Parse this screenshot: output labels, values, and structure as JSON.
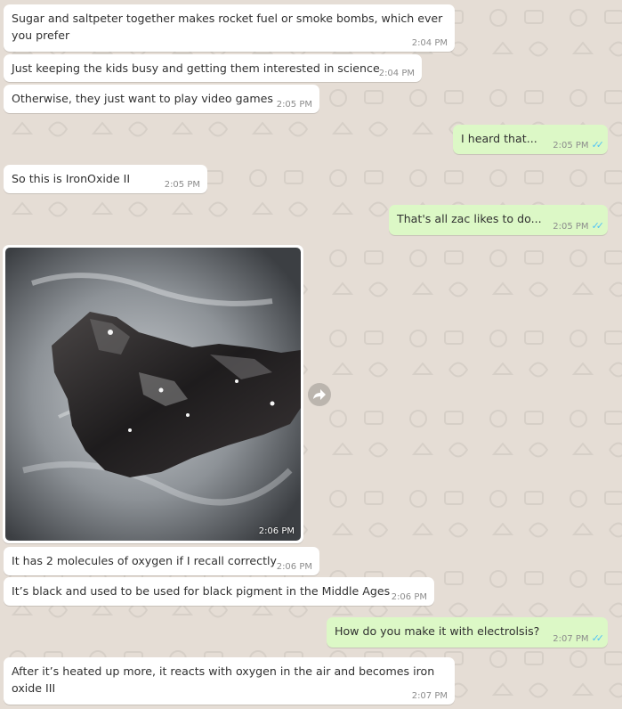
{
  "messages": [
    {
      "text": "Sugar and saltpeter together makes rocket fuel or smoke bombs, which ever you prefer",
      "time": "2:04 PM"
    },
    {
      "text": "Just keeping the kids busy and getting them interested in science",
      "time": "2:04 PM"
    },
    {
      "text": "Otherwise, they just want to play video games",
      "time": "2:05 PM"
    },
    {
      "text": "I heard that...",
      "time": "2:05 PM"
    },
    {
      "text": "So this is IronOxide II",
      "time": "2:05 PM"
    },
    {
      "text": "That's all zac likes to do...",
      "time": "2:05 PM"
    },
    {
      "text": "",
      "time": "2:06 PM"
    },
    {
      "text": "It has 2 molecules of oxygen if I recall correctly",
      "time": "2:06 PM"
    },
    {
      "text": "It’s black and used to be used for black pigment in the Middle Ages",
      "time": "2:06 PM"
    },
    {
      "text": "How do you make it with electrolsis?",
      "time": "2:07 PM"
    },
    {
      "text": "After it’s heated up more, it reacts with oxygen in the air and becomes iron oxide III",
      "time": "2:07 PM"
    }
  ],
  "icons": {
    "read_ticks": "double-check-icon",
    "forward": "forward-arrow-icon"
  },
  "colors": {
    "background": "#e5ddd5",
    "incoming": "#ffffff",
    "outgoing": "#dcf8c6",
    "ticks": "#4fc3f7"
  }
}
